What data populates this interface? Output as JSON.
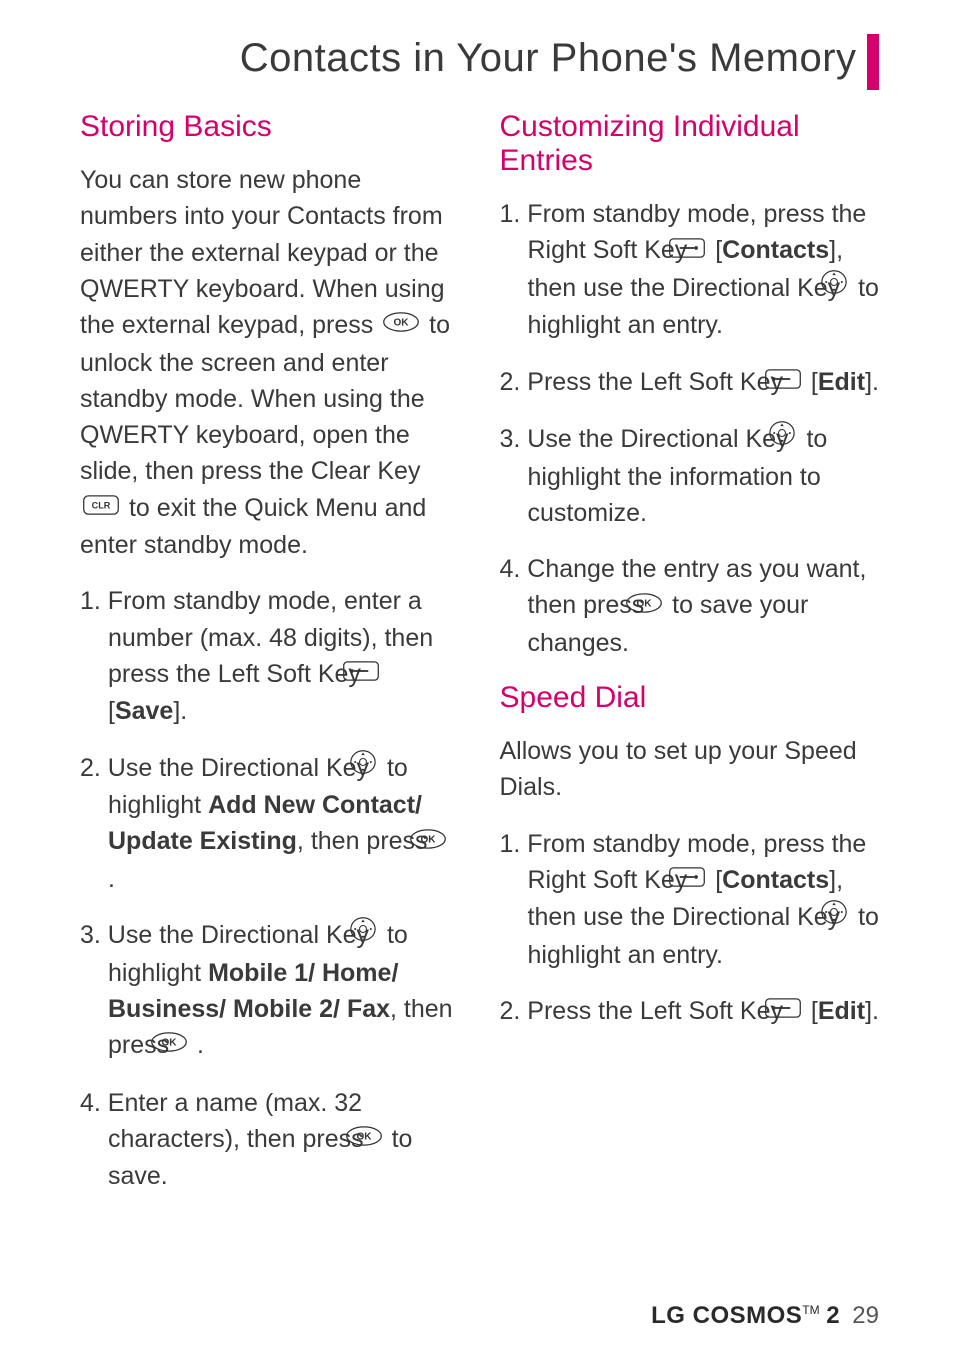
{
  "page_title": "Contacts in Your Phone's Memory",
  "left": {
    "h1": "Storing Basics",
    "intro_a": "You can store new phone numbers into your Contacts from either the external keypad or the QWERTY keyboard. When using the external keypad, press ",
    "intro_b": " to unlock the screen and enter standby mode. When using the QWERTY keyboard, open the slide, then press the Clear Key ",
    "intro_c": " to exit the Quick Menu and enter standby mode.",
    "s1_a": "1. From standby mode, enter a number (max. 48 digits), then press the Left Soft Key ",
    "s1_b": " [",
    "s1_bold": "Save",
    "s1_c": "].",
    "s2_a": "2. Use the Directional Key ",
    "s2_b": " to highlight ",
    "s2_bold": "Add New Contact/ Update Existing",
    "s2_c": ", then press ",
    "s2_d": " .",
    "s3_a": "3. Use the Directional Key ",
    "s3_b": " to highlight ",
    "s3_bold": "Mobile 1/ Home/ Business/ Mobile 2/ Fax",
    "s3_c": ", then press ",
    "s3_d": " .",
    "s4_a": "4. Enter a name (max. 32 characters), then press ",
    "s4_b": " to save."
  },
  "right": {
    "h1": "Customizing Individual Entries",
    "s1_a": "1. From standby mode, press the Right Soft Key ",
    "s1_b": " [",
    "s1_bold": "Contacts",
    "s1_c": "], then use the Directional Key ",
    "s1_d": " to highlight an entry.",
    "s2_a": "2. Press the Left Soft Key ",
    "s2_b": " [",
    "s2_bold": "Edit",
    "s2_c": "].",
    "s3_a": "3. Use the Directional Key ",
    "s3_b": " to highlight the information to customize.",
    "s4_a": "4. Change the entry as you want, then press ",
    "s4_b": " to save your changes.",
    "h2": "Speed Dial",
    "sd_intro": "Allows you to set up your Speed Dials.",
    "sd1_a": "1. From standby mode, press the Right Soft Key ",
    "sd1_b": " [",
    "sd1_bold": "Contacts",
    "sd1_c": "], then use the Directional Key ",
    "sd1_d": " to highlight an entry.",
    "sd2_a": "2. Press the Left Soft Key ",
    "sd2_b": " [",
    "sd2_bold": "Edit",
    "sd2_c": "]."
  },
  "footer": {
    "brand": "LG COSMOS",
    "model": " 2",
    "page": "29"
  }
}
